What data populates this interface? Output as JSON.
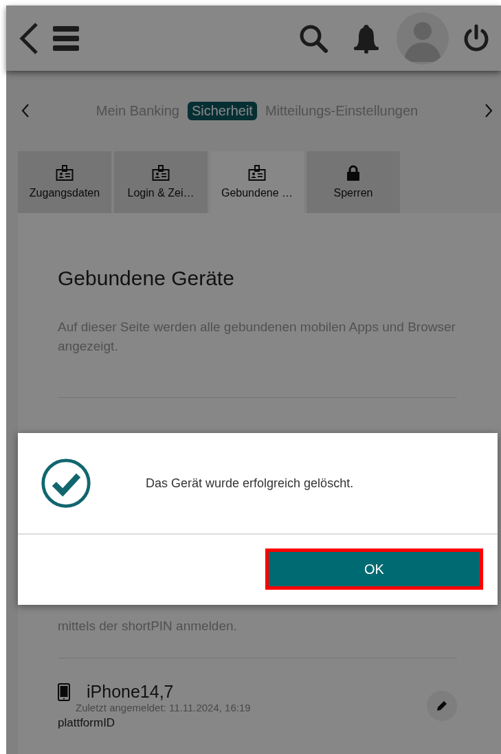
{
  "nav": {
    "items": [
      {
        "label": "Mein Banking",
        "selected": false
      },
      {
        "label": "Sicherheit",
        "selected": true
      },
      {
        "label": "Mitteilungs-Einstellungen",
        "selected": false
      }
    ]
  },
  "tabs": [
    {
      "label": "Zugangsdaten",
      "kind": "card",
      "selected": false
    },
    {
      "label": "Login & Zei…",
      "kind": "card",
      "selected": false
    },
    {
      "label": "Gebundene …",
      "kind": "card",
      "selected": true
    },
    {
      "label": "Sperren",
      "kind": "lock",
      "selected": false
    }
  ],
  "section": {
    "title": "Gebundene Geräte",
    "description": "Auf dieser Seite werden alle gebundenen mobilen Apps und Browser angezeigt.",
    "note_visible_part": "mittels der shortPIN anmelden."
  },
  "devices": [
    {
      "name": "iPhone14,7",
      "last_login": "Zuletzt angemeldet: 11.11.2024, 16:19",
      "platform": "plattformID"
    }
  ],
  "dialog": {
    "message": "Das Gerät wurde erfolgreich gelöscht.",
    "button": {
      "label": "OK",
      "highlighted": true
    }
  }
}
